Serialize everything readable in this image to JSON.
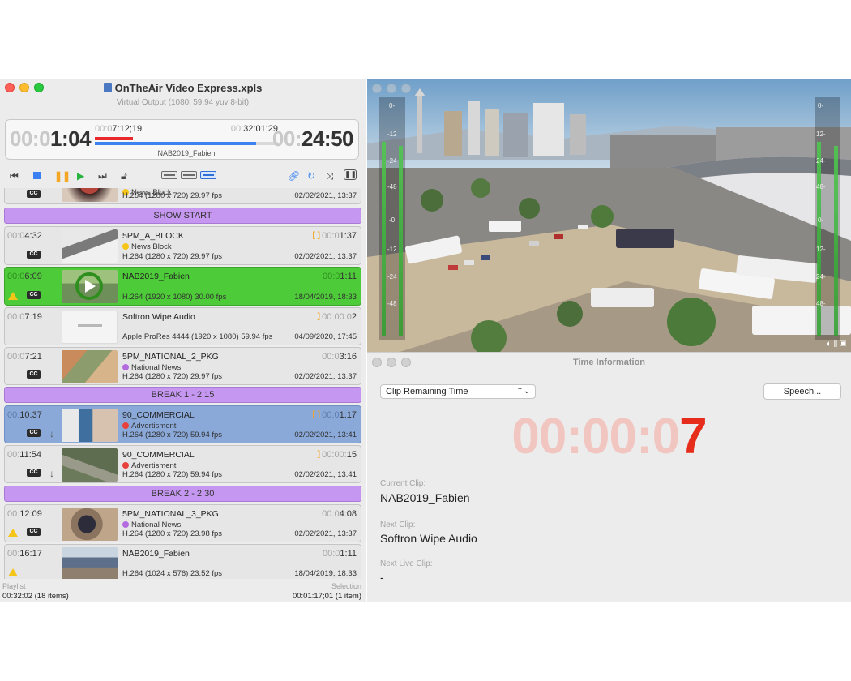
{
  "app": {
    "window_title": "OnTheAir Video Express.xpls",
    "subtitle": "Virtual Output (1080i 59.94 yuv 8-bit)"
  },
  "clock": {
    "elapsed_dim": "00:0",
    "elapsed": "1:04",
    "clip_elapsed_dim": "00:0",
    "clip_elapsed": "7:12;19",
    "total_dim": "00:",
    "total": "32:01;29",
    "clip_name": "NAB2019_Fabien",
    "remaining_dim": "00:",
    "remaining": "24:50",
    "elapsed_progress": 0.21,
    "clip_progress": 0.88
  },
  "toolbar": {
    "skip_back": "skip-back",
    "stop": "stop",
    "pause": "pause",
    "play": "play",
    "skip_forward": "skip-forward"
  },
  "playlist": {
    "partial_row": {
      "category": "News Block",
      "category_color": "#f5c518",
      "format": "H.264 (1280 x 720) 29.97 fps",
      "date": "02/02/2021, 13:37"
    },
    "headers": [
      "SHOW START",
      "BREAK 1 - 2:15",
      "BREAK 2 - 2:30"
    ],
    "rows": [
      {
        "time_dim": "00:0",
        "time": "4:32",
        "title": "5PM_A_BLOCK",
        "category": "News Block",
        "category_color": "#f5c518",
        "format": "H.264 (1280 x 720) 29.97 fps",
        "date": "02/02/2021, 13:37",
        "dur_dim": "00:0",
        "dur": "1:37"
      },
      {
        "time_dim": "00:0",
        "time": "6:09",
        "title": "NAB2019_Fabien",
        "category": "",
        "category_color": "",
        "format": "H.264 (1920 x 1080) 30.00 fps",
        "date": "18/04/2019, 18:33",
        "dur_dim": "00:0",
        "dur": "1:11"
      },
      {
        "time_dim": "00:0",
        "time": "7:19",
        "title": "Softron Wipe Audio",
        "category": "",
        "category_color": "",
        "format": "Apple ProRes 4444 (1920 x 1080) 59.94 fps",
        "date": "04/09/2020, 17:45",
        "dur_dim": "00:00:0",
        "dur": "2"
      },
      {
        "time_dim": "00:0",
        "time": "7:21",
        "title": "5PM_NATIONAL_2_PKG",
        "category": "National News",
        "category_color": "#b46be0",
        "format": "H.264 (1280 x 720) 29.97 fps",
        "date": "02/02/2021, 13:37",
        "dur_dim": "00:0",
        "dur": "3:16"
      },
      {
        "time_dim": "00:",
        "time": "10:37",
        "title": "90_COMMERCIAL",
        "category": "Advertisment",
        "category_color": "#e8403a",
        "format": "H.264 (1280 x 720) 59.94 fps",
        "date": "02/02/2021, 13:41",
        "dur_dim": "00:0",
        "dur": "1:17"
      },
      {
        "time_dim": "00:",
        "time": "11:54",
        "title": "90_COMMERCIAL",
        "category": "Advertisment",
        "category_color": "#e8403a",
        "format": "H.264 (1280 x 720) 59.94 fps",
        "date": "02/02/2021, 13:41",
        "dur_dim": "00:00:",
        "dur": "15"
      },
      {
        "time_dim": "00:",
        "time": "12:09",
        "title": "5PM_NATIONAL_3_PKG",
        "category": "National News",
        "category_color": "#b46be0",
        "format": "H.264 (1280 x 720) 23.98 fps",
        "date": "02/02/2021, 13:37",
        "dur_dim": "00:0",
        "dur": "4:08"
      },
      {
        "time_dim": "00:",
        "time": "16:17",
        "title": "NAB2019_Fabien",
        "category": "",
        "category_color": "",
        "format": "H.264 (1024 x 576) 23.52 fps",
        "date": "18/04/2019, 18:33",
        "dur_dim": "00:0",
        "dur": "1:11"
      }
    ],
    "cc_label": "CC"
  },
  "status": {
    "playlist_label": "Playlist",
    "playlist_value": "00:32:02 (18 items)",
    "selection_label": "Selection",
    "selection_value": "00:01:17;01 (1 item)"
  },
  "meters": {
    "left_labels": [
      "0-",
      "-12",
      "-24",
      "-48",
      "-0",
      "-12",
      "-24",
      "-48"
    ],
    "right_labels": [
      "0-",
      "12-",
      "24-",
      "48-",
      "0-",
      "12-",
      "24-",
      "48-"
    ]
  },
  "time_info": {
    "window_title": "Time Information",
    "mode": "Clip Remaining Time",
    "speech_button": "Speech...",
    "countdown_dim": "00:00:0",
    "countdown_hot": "7",
    "current_clip_label": "Current Clip:",
    "current_clip": "NAB2019_Fabien",
    "next_clip_label": "Next Clip:",
    "next_clip": "Softron Wipe Audio",
    "next_live_label": "Next Live Clip:",
    "next_live": "-",
    "countdown_color": "#e62d1c"
  }
}
